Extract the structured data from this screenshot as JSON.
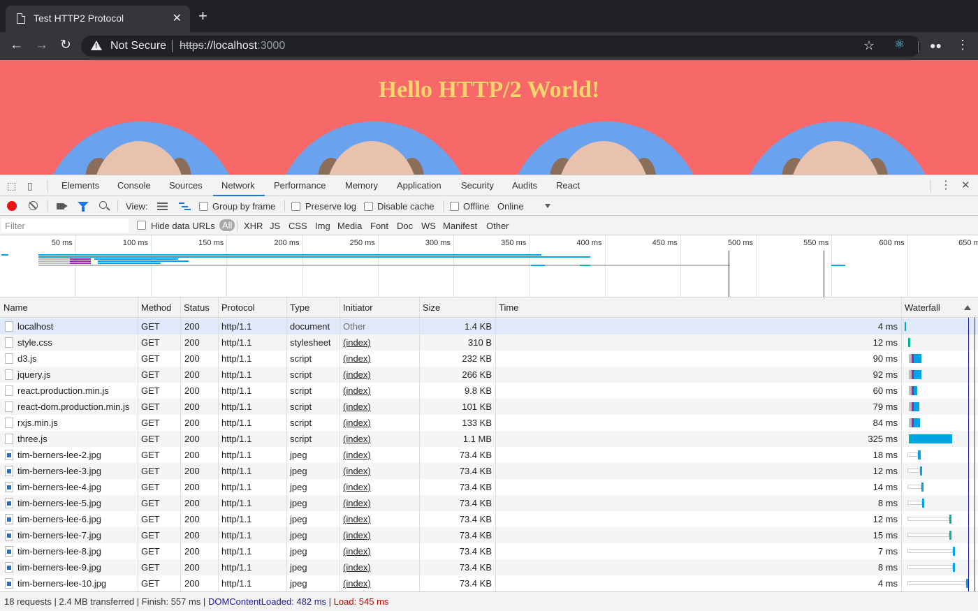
{
  "browser": {
    "tab_title": "Test HTTP2 Protocol",
    "tab_close": "✕",
    "new_tab": "+",
    "security_label": "Not Secure",
    "url_scheme": "https",
    "url_rest": "://localhost",
    "url_port": ":3000"
  },
  "page": {
    "heading": "Hello HTTP/2 World!"
  },
  "devtools": {
    "tabs": [
      "Elements",
      "Console",
      "Sources",
      "Network",
      "Performance",
      "Memory",
      "Application",
      "Security",
      "Audits",
      "React"
    ],
    "active_tab": "Network"
  },
  "network_toolbar": {
    "view_label": "View:",
    "group_by_frame": "Group by frame",
    "preserve_log": "Preserve log",
    "disable_cache": "Disable cache",
    "offline": "Offline",
    "throttle": "Online"
  },
  "filter_bar": {
    "placeholder": "Filter",
    "hide_data_urls": "Hide data URLs",
    "types": [
      "All",
      "XHR",
      "JS",
      "CSS",
      "Img",
      "Media",
      "Font",
      "Doc",
      "WS",
      "Manifest",
      "Other"
    ]
  },
  "overview": {
    "ticks": [
      "50 ms",
      "100 ms",
      "150 ms",
      "200 ms",
      "250 ms",
      "300 ms",
      "350 ms",
      "400 ms",
      "450 ms",
      "500 ms",
      "550 ms",
      "600 ms",
      "650 m"
    ],
    "dom_content_loaded_ms": 482,
    "load_ms": 545
  },
  "table": {
    "columns": [
      "Name",
      "Method",
      "Status",
      "Protocol",
      "Type",
      "Initiator",
      "Size",
      "Time",
      "Waterfall"
    ],
    "rows": [
      {
        "name": "localhost",
        "method": "GET",
        "status": "200",
        "protocol": "http/1.1",
        "type": "document",
        "initiator": "Other",
        "size": "1.4 KB",
        "time": "4 ms",
        "icon": "file-icon"
      },
      {
        "name": "style.css",
        "method": "GET",
        "status": "200",
        "protocol": "http/1.1",
        "type": "stylesheet",
        "initiator": "(index)",
        "size": "310 B",
        "time": "12 ms",
        "icon": "file-icon"
      },
      {
        "name": "d3.js",
        "method": "GET",
        "status": "200",
        "protocol": "http/1.1",
        "type": "script",
        "initiator": "(index)",
        "size": "232 KB",
        "time": "90 ms",
        "icon": "file-icon"
      },
      {
        "name": "jquery.js",
        "method": "GET",
        "status": "200",
        "protocol": "http/1.1",
        "type": "script",
        "initiator": "(index)",
        "size": "266 KB",
        "time": "92 ms",
        "icon": "file-icon"
      },
      {
        "name": "react.production.min.js",
        "method": "GET",
        "status": "200",
        "protocol": "http/1.1",
        "type": "script",
        "initiator": "(index)",
        "size": "9.8 KB",
        "time": "60 ms",
        "icon": "file-icon"
      },
      {
        "name": "react-dom.production.min.js",
        "method": "GET",
        "status": "200",
        "protocol": "http/1.1",
        "type": "script",
        "initiator": "(index)",
        "size": "101 KB",
        "time": "79 ms",
        "icon": "file-icon"
      },
      {
        "name": "rxjs.min.js",
        "method": "GET",
        "status": "200",
        "protocol": "http/1.1",
        "type": "script",
        "initiator": "(index)",
        "size": "133 KB",
        "time": "84 ms",
        "icon": "file-icon"
      },
      {
        "name": "three.js",
        "method": "GET",
        "status": "200",
        "protocol": "http/1.1",
        "type": "script",
        "initiator": "(index)",
        "size": "1.1 MB",
        "time": "325 ms",
        "icon": "file-icon"
      },
      {
        "name": "tim-berners-lee-2.jpg",
        "method": "GET",
        "status": "200",
        "protocol": "http/1.1",
        "type": "jpeg",
        "initiator": "(index)",
        "size": "73.4 KB",
        "time": "18 ms",
        "icon": "image-icon"
      },
      {
        "name": "tim-berners-lee-3.jpg",
        "method": "GET",
        "status": "200",
        "protocol": "http/1.1",
        "type": "jpeg",
        "initiator": "(index)",
        "size": "73.4 KB",
        "time": "12 ms",
        "icon": "image-icon"
      },
      {
        "name": "tim-berners-lee-4.jpg",
        "method": "GET",
        "status": "200",
        "protocol": "http/1.1",
        "type": "jpeg",
        "initiator": "(index)",
        "size": "73.4 KB",
        "time": "14 ms",
        "icon": "image-icon"
      },
      {
        "name": "tim-berners-lee-5.jpg",
        "method": "GET",
        "status": "200",
        "protocol": "http/1.1",
        "type": "jpeg",
        "initiator": "(index)",
        "size": "73.4 KB",
        "time": "8 ms",
        "icon": "image-icon"
      },
      {
        "name": "tim-berners-lee-6.jpg",
        "method": "GET",
        "status": "200",
        "protocol": "http/1.1",
        "type": "jpeg",
        "initiator": "(index)",
        "size": "73.4 KB",
        "time": "12 ms",
        "icon": "image-icon"
      },
      {
        "name": "tim-berners-lee-7.jpg",
        "method": "GET",
        "status": "200",
        "protocol": "http/1.1",
        "type": "jpeg",
        "initiator": "(index)",
        "size": "73.4 KB",
        "time": "15 ms",
        "icon": "image-icon"
      },
      {
        "name": "tim-berners-lee-8.jpg",
        "method": "GET",
        "status": "200",
        "protocol": "http/1.1",
        "type": "jpeg",
        "initiator": "(index)",
        "size": "73.4 KB",
        "time": "7 ms",
        "icon": "image-icon"
      },
      {
        "name": "tim-berners-lee-9.jpg",
        "method": "GET",
        "status": "200",
        "protocol": "http/1.1",
        "type": "jpeg",
        "initiator": "(index)",
        "size": "73.4 KB",
        "time": "8 ms",
        "icon": "image-icon"
      },
      {
        "name": "tim-berners-lee-10.jpg",
        "method": "GET",
        "status": "200",
        "protocol": "http/1.1",
        "type": "jpeg",
        "initiator": "(index)",
        "size": "73.4 KB",
        "time": "4 ms",
        "icon": "image-icon"
      }
    ]
  },
  "status": {
    "summary": "18 requests | 2.4 MB transferred | Finish: 557 ms | ",
    "dom_content_loaded": "DOMContentLoaded: 482 ms",
    "separator": " | ",
    "load": "Load: 545 ms"
  },
  "colors": {
    "page_background": "#f76868",
    "heading": "#f9d66b",
    "accent": "#1a73e8",
    "record": "#e41616",
    "dcl_line": "#1a1aa6",
    "load_line": "#c80000",
    "waterfall_download": "#00a4e4",
    "waterfall_stylesheet": "#00b894"
  }
}
